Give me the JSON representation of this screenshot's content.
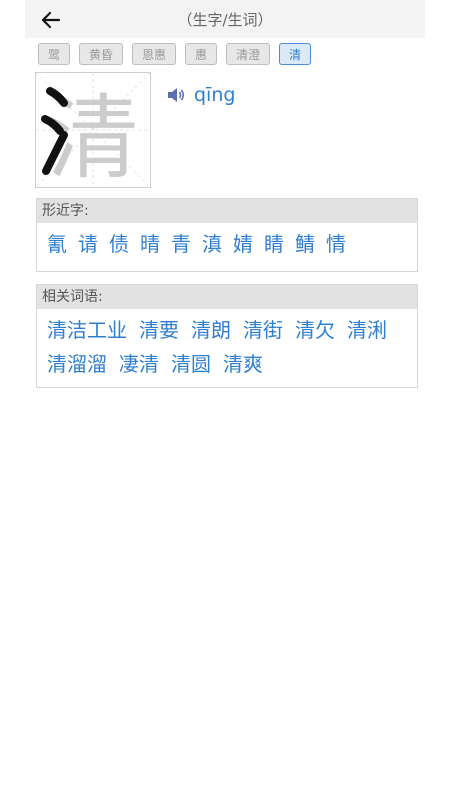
{
  "header": {
    "title": "（生字/生词）",
    "back_icon": "arrow-left-icon"
  },
  "tabs": [
    {
      "label": "鹭",
      "active": false
    },
    {
      "label": "黄昏",
      "active": false
    },
    {
      "label": "恩惠",
      "active": false
    },
    {
      "label": "惠",
      "active": false
    },
    {
      "label": "清澄",
      "active": false
    },
    {
      "label": "清",
      "active": true
    }
  ],
  "character": {
    "char": "清",
    "pinyin": "qīng",
    "speaker_icon": "speaker-icon"
  },
  "similar": {
    "heading": "形近字:",
    "items": [
      "氰",
      "请",
      "债",
      "晴",
      "青",
      "滇",
      "婧",
      "睛",
      "鲭",
      "情"
    ]
  },
  "related": {
    "heading": "相关词语:",
    "items": [
      "清洁工业",
      "清要",
      "清朗",
      "清街",
      "清欠",
      "清浰",
      "清溜溜",
      "凄清",
      "清圆",
      "清爽"
    ]
  },
  "colors": {
    "accent": "#2f7fd0",
    "tab_active_bg": "#dbe9f7",
    "header_bg": "#f3f3f3"
  }
}
